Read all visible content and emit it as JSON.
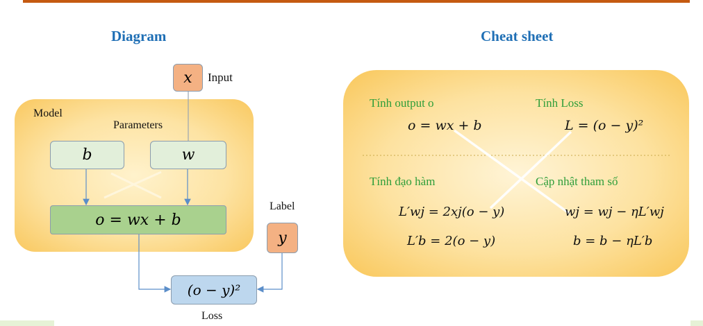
{
  "diagram": {
    "title": "Diagram",
    "input_label": "Input",
    "input_symbol": "x",
    "model_label": "Model",
    "parameters_label": "Parameters",
    "param_b": "b",
    "param_w": "w",
    "output_formula": "o = wx + b",
    "label_label": "Label",
    "label_symbol": "y",
    "loss_formula": "(o − y)²",
    "loss_label": "Loss"
  },
  "cheat_sheet": {
    "title": "Cheat sheet",
    "output_heading": "Tính output o",
    "output_formula": "o = wx + b",
    "loss_heading": "Tính Loss",
    "loss_formula": "L = (o − y)²",
    "derivative_heading": "Tính đạo hàm",
    "derivative_w": "L′wj = 2xj(o − y)",
    "derivative_b": "L′b = 2(o − y)",
    "update_heading": "Cập nhật tham số",
    "update_w": "wj = wj − ηL′wj",
    "update_b": "b = b − ηL′b"
  },
  "colors": {
    "accent_bar": "#c55a11",
    "title_blue": "#1f6fb5",
    "model_fill": "#fdd98a",
    "param_fill": "#e2efda",
    "output_fill": "#a9d18e",
    "input_fill": "#f4b183",
    "loss_fill": "#bdd7ee",
    "heading_green": "#2e9e3a",
    "arrow_blue": "#5b8ec9"
  }
}
